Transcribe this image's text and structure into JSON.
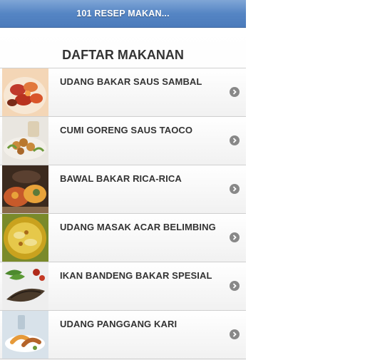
{
  "header": {
    "title": "101 RESEP MAKAN..."
  },
  "main": {
    "list_title": "DAFTAR MAKANAN",
    "items": [
      {
        "label": "UDANG BAKAR SAUS SAMBAL",
        "thumb_icon": "shrimp-dish-photo-icon",
        "colors": [
          "#c0392b",
          "#e2783c",
          "#f4d6b6",
          "#7a2a18"
        ]
      },
      {
        "label": "CUMI GORENG SAUS TAOCO",
        "thumb_icon": "fried-squid-photo-icon",
        "colors": [
          "#f2efe9",
          "#c98a3c",
          "#6d9a3a",
          "#d9c9a8"
        ]
      },
      {
        "label": "BAWAL BAKAR RICA-RICA",
        "thumb_icon": "grilled-fish-photo-icon",
        "colors": [
          "#3b2a1e",
          "#c75a2a",
          "#e8a33a",
          "#5c7a3a"
        ]
      },
      {
        "label": "UDANG MASAK ACAR BELIMBING",
        "thumb_icon": "shrimp-curry-photo-icon",
        "colors": [
          "#c9a21e",
          "#e6c84a",
          "#7a8a2a",
          "#a86a1a"
        ]
      },
      {
        "label": "IKAN BANDENG BAKAR SPESIAL",
        "thumb_icon": "milkfish-photo-icon",
        "colors": [
          "#eeeeee",
          "#4a3a2a",
          "#4d8a2e",
          "#b02a1a"
        ]
      },
      {
        "label": "UDANG PANGGANG KARI",
        "thumb_icon": "grilled-prawn-photo-icon",
        "colors": [
          "#d8e2ea",
          "#e69a3a",
          "#ffffff",
          "#b5642a"
        ]
      }
    ]
  },
  "accent_colors": {
    "header": "#5585c4",
    "arrow": "#888888"
  }
}
